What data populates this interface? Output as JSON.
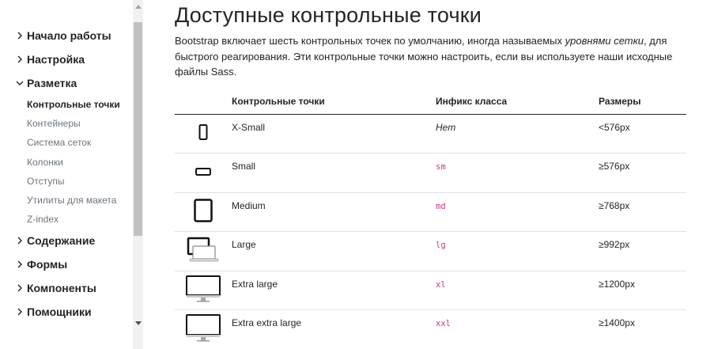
{
  "sidebar": {
    "groups_top": [
      {
        "label": "Начало работы"
      },
      {
        "label": "Настройка"
      }
    ],
    "expanded_group": {
      "label": "Разметка",
      "items": [
        {
          "label": "Контрольные точки",
          "active": true
        },
        {
          "label": "Контейнеры"
        },
        {
          "label": "Система сеток"
        },
        {
          "label": "Колонки"
        },
        {
          "label": "Отступы"
        },
        {
          "label": "Утилиты для макета"
        },
        {
          "label": "Z-index"
        }
      ]
    },
    "groups_bottom": [
      {
        "label": "Содержание"
      },
      {
        "label": "Формы"
      },
      {
        "label": "Компоненты"
      },
      {
        "label": "Помощники"
      }
    ]
  },
  "main": {
    "title": "Доступные контрольные точки",
    "lead_part1": "Bootstrap включает шесть контрольных точек по умолчанию, иногда называемых ",
    "lead_em": "уровнями сетки",
    "lead_part2": ", для быстрого реагирования. Эти контрольные точки можно настроить, если вы используете наши исходные файлы Sass.",
    "table": {
      "headers": [
        "Контрольные точки",
        "Инфикс класса",
        "Размеры"
      ],
      "rows": [
        {
          "icon": "phone-portrait-icon",
          "name": "X-Small",
          "infix": "Нет",
          "infix_is_code": false,
          "size": "<576px"
        },
        {
          "icon": "phone-landscape-icon",
          "name": "Small",
          "infix": "sm",
          "infix_is_code": true,
          "size": "≥576px"
        },
        {
          "icon": "tablet-icon",
          "name": "Medium",
          "infix": "md",
          "infix_is_code": true,
          "size": "≥768px"
        },
        {
          "icon": "laptop-icon",
          "name": "Large",
          "infix": "lg",
          "infix_is_code": true,
          "size": "≥992px"
        },
        {
          "icon": "desktop-icon",
          "name": "Extra large",
          "infix": "xl",
          "infix_is_code": true,
          "size": "≥1200px"
        },
        {
          "icon": "large-desktop-icon",
          "name": "Extra extra large",
          "infix": "xxl",
          "infix_is_code": true,
          "size": "≥1400px"
        }
      ]
    }
  },
  "colors": {
    "code": "#d63384",
    "muted": "#6c757d",
    "text": "#212529"
  }
}
